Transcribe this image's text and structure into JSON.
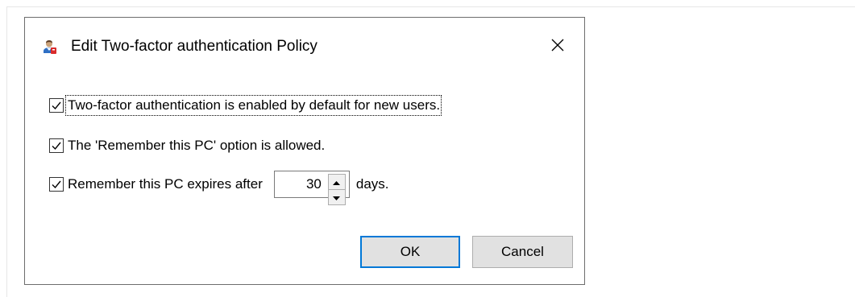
{
  "window": {
    "title": "Edit Two-factor authentication Policy",
    "icon": "user-shield-icon",
    "close_icon": "close-icon"
  },
  "options": [
    {
      "label": "Two-factor authentication is enabled by default for new users.",
      "checked": true,
      "focused": true
    },
    {
      "label": "The 'Remember this PC' option is allowed.",
      "checked": true
    },
    {
      "label": "Remember this PC expires after",
      "checked": true
    }
  ],
  "expiry": {
    "value": "30",
    "unit_label": "days."
  },
  "buttons": {
    "ok_label": "OK",
    "cancel_label": "Cancel"
  },
  "colors": {
    "accent": "#0078d7",
    "button_face": "#e1e1e1",
    "dialog_border": "#6d6d6d"
  }
}
